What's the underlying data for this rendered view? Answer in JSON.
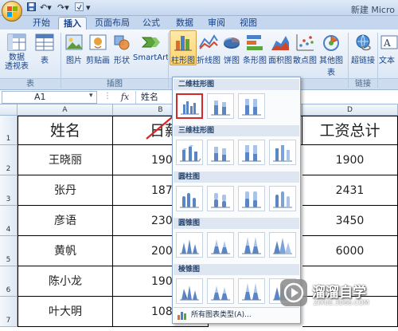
{
  "title_bar": {
    "title": "新建 Micro",
    "quick_access": [
      "save-icon",
      "undo-icon",
      "redo-icon",
      "customize-icon"
    ]
  },
  "tabs": [
    {
      "label": "开始"
    },
    {
      "label": "插入"
    },
    {
      "label": "页面布局"
    },
    {
      "label": "公式"
    },
    {
      "label": "数据"
    },
    {
      "label": "审阅"
    },
    {
      "label": "视图"
    }
  ],
  "active_tab": "插入",
  "ribbon": {
    "groups": [
      {
        "label": "表",
        "buttons": [
          {
            "label": "数据\n透视表",
            "icon": "pivot-table-icon"
          },
          {
            "label": "表",
            "icon": "table-icon"
          }
        ]
      },
      {
        "label": "插图",
        "buttons": [
          {
            "label": "图片",
            "icon": "picture-icon"
          },
          {
            "label": "剪贴画",
            "icon": "clipart-icon"
          },
          {
            "label": "形状",
            "icon": "shapes-icon"
          },
          {
            "label": "SmartArt",
            "icon": "smartart-icon"
          }
        ]
      },
      {
        "label": "",
        "buttons": [
          {
            "label": "柱形图",
            "icon": "column-chart-icon"
          },
          {
            "label": "折线图",
            "icon": "line-chart-icon"
          },
          {
            "label": "饼图",
            "icon": "pie-chart-icon"
          },
          {
            "label": "条形图",
            "icon": "bar-chart-icon"
          },
          {
            "label": "面积图",
            "icon": "area-chart-icon"
          },
          {
            "label": "散点图",
            "icon": "scatter-chart-icon"
          },
          {
            "label": "其他图表",
            "icon": "other-charts-icon"
          }
        ]
      },
      {
        "label": "链接",
        "buttons": [
          {
            "label": "超链接",
            "icon": "hyperlink-icon"
          }
        ]
      },
      {
        "label": "",
        "buttons": [
          {
            "label": "文本",
            "icon": "textbox-icon"
          }
        ]
      }
    ]
  },
  "formula_bar": {
    "name_box": "A1",
    "fx": "fx",
    "value": "姓名"
  },
  "columns": [
    "A",
    "B",
    "D"
  ],
  "rows": [
    "1",
    "2",
    "3",
    "4",
    "5",
    "6",
    "7"
  ],
  "table": {
    "header": [
      "姓名",
      "日薪",
      "工资总计"
    ],
    "rows": [
      [
        "王晓丽",
        "190",
        "1900"
      ],
      [
        "张丹",
        "187",
        "2431"
      ],
      [
        "彦语",
        "230",
        "3450"
      ],
      [
        "黄帆",
        "200",
        "6000"
      ],
      [
        "陈小龙",
        "190",
        ""
      ],
      [
        "叶大明",
        "108",
        ""
      ]
    ]
  },
  "dropdown": {
    "sections": [
      {
        "title": "二维柱形图",
        "options": [
          "clustered-column",
          "stacked-column",
          "100pct-stacked-column"
        ],
        "selected": 0
      },
      {
        "title": "三维柱形图",
        "options": [
          "3d-clustered-column",
          "3d-stacked-column",
          "3d-100pct-stacked-column",
          "3d-column"
        ]
      },
      {
        "title": "圆柱图",
        "options": [
          "clustered-cylinder",
          "stacked-cylinder",
          "100pct-stacked-cylinder",
          "3d-cylinder"
        ]
      },
      {
        "title": "圆锥图",
        "options": [
          "clustered-cone",
          "stacked-cone",
          "100pct-stacked-cone",
          "3d-cone"
        ]
      },
      {
        "title": "棱锥图",
        "options": [
          "clustered-pyramid",
          "stacked-pyramid",
          "100pct-stacked-pyramid",
          "3d-pyramid"
        ]
      }
    ],
    "footer": "所有图表类型(A)..."
  },
  "watermark": {
    "title": "溜溜自学",
    "subtitle": "ZIXUE.3D66.COM"
  },
  "colors": {
    "accent": "#15428b",
    "selection": "#d4282a",
    "ribbon": "#dfe9f6"
  }
}
